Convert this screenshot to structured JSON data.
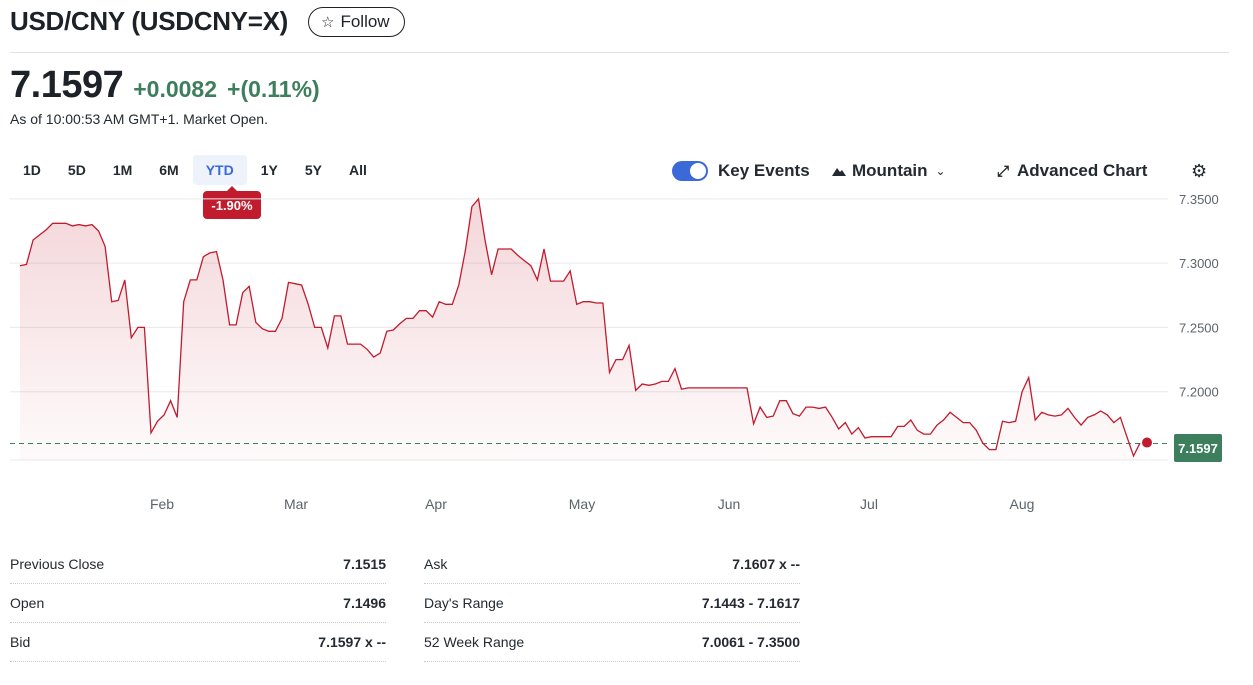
{
  "header": {
    "title": "USD/CNY (USDCNY=X)",
    "follow_label": "Follow",
    "follow_icon": "star-outline-icon"
  },
  "quote": {
    "price": "7.1597",
    "change": "+0.0082",
    "change_pct": "+(0.11%)",
    "as_of": "As of 10:00:53 AM GMT+1. Market Open.",
    "change_color": "#3d7f5c"
  },
  "ranges": {
    "items": [
      "1D",
      "5D",
      "1M",
      "6M",
      "YTD",
      "1Y",
      "5Y",
      "All"
    ],
    "active": "YTD",
    "ytd_change": "-1.90%"
  },
  "toolbar": {
    "key_events_label": "Key Events",
    "key_events_on": true,
    "chart_type_label": "Mountain",
    "advanced_label": "Advanced Chart",
    "settings_icon": "gear-icon"
  },
  "chart_data": {
    "type": "area",
    "x_labels": [
      "Feb",
      "Mar",
      "Apr",
      "May",
      "Jun",
      "Jul",
      "Aug"
    ],
    "y_ticks": [
      "7.3500",
      "7.3000",
      "7.2500",
      "7.2000"
    ],
    "ylim": [
      7.143,
      7.353
    ],
    "current_value": "7.1597",
    "reference_line": 7.1597,
    "line_color": "#c11b2e",
    "fill_color": "#c11b2e",
    "values": [
      7.298,
      7.299,
      7.318,
      7.322,
      7.326,
      7.331,
      7.331,
      7.331,
      7.329,
      7.33,
      7.329,
      7.33,
      7.325,
      7.313,
      7.27,
      7.271,
      7.287,
      7.242,
      7.25,
      7.25,
      7.168,
      7.177,
      7.182,
      7.193,
      7.18,
      7.27,
      7.287,
      7.287,
      7.305,
      7.308,
      7.309,
      7.287,
      7.252,
      7.252,
      7.277,
      7.282,
      7.254,
      7.249,
      7.247,
      7.247,
      7.257,
      7.285,
      7.284,
      7.283,
      7.268,
      7.25,
      7.25,
      7.234,
      7.259,
      7.259,
      7.237,
      7.237,
      7.237,
      7.233,
      7.227,
      7.23,
      7.247,
      7.248,
      7.253,
      7.257,
      7.257,
      7.263,
      7.263,
      7.258,
      7.27,
      7.268,
      7.268,
      7.283,
      7.31,
      7.344,
      7.35,
      7.318,
      7.291,
      7.311,
      7.311,
      7.311,
      7.306,
      7.302,
      7.298,
      7.287,
      7.311,
      7.286,
      7.286,
      7.286,
      7.294,
      7.268,
      7.27,
      7.27,
      7.269,
      7.269,
      7.215,
      7.225,
      7.225,
      7.236,
      7.201,
      7.206,
      7.205,
      7.206,
      7.208,
      7.208,
      7.218,
      7.202,
      7.203,
      7.203,
      7.203,
      7.203,
      7.203,
      7.203,
      7.203,
      7.203,
      7.203,
      7.203,
      7.175,
      7.188,
      7.18,
      7.181,
      7.193,
      7.193,
      7.183,
      7.181,
      7.188,
      7.188,
      7.187,
      7.188,
      7.18,
      7.171,
      7.176,
      7.167,
      7.172,
      7.164,
      7.165,
      7.165,
      7.165,
      7.165,
      7.173,
      7.173,
      7.178,
      7.17,
      7.167,
      7.167,
      7.174,
      7.178,
      7.184,
      7.18,
      7.176,
      7.176,
      7.17,
      7.16,
      7.155,
      7.155,
      7.177,
      7.176,
      7.177,
      7.2,
      7.211,
      7.178,
      7.184,
      7.182,
      7.181,
      7.182,
      7.187,
      7.18,
      7.174,
      7.18,
      7.182,
      7.185,
      7.182,
      7.176,
      7.18,
      7.165,
      7.15,
      7.16
    ]
  },
  "stats": {
    "left": [
      {
        "label": "Previous Close",
        "value": "7.1515"
      },
      {
        "label": "Open",
        "value": "7.1496"
      },
      {
        "label": "Bid",
        "value": "7.1597 x --"
      }
    ],
    "right": [
      {
        "label": "Ask",
        "value": "7.1607 x --"
      },
      {
        "label": "Day's Range",
        "value": "7.1443 - 7.1617"
      },
      {
        "label": "52 Week Range",
        "value": "7.0061 - 7.3500"
      }
    ]
  }
}
